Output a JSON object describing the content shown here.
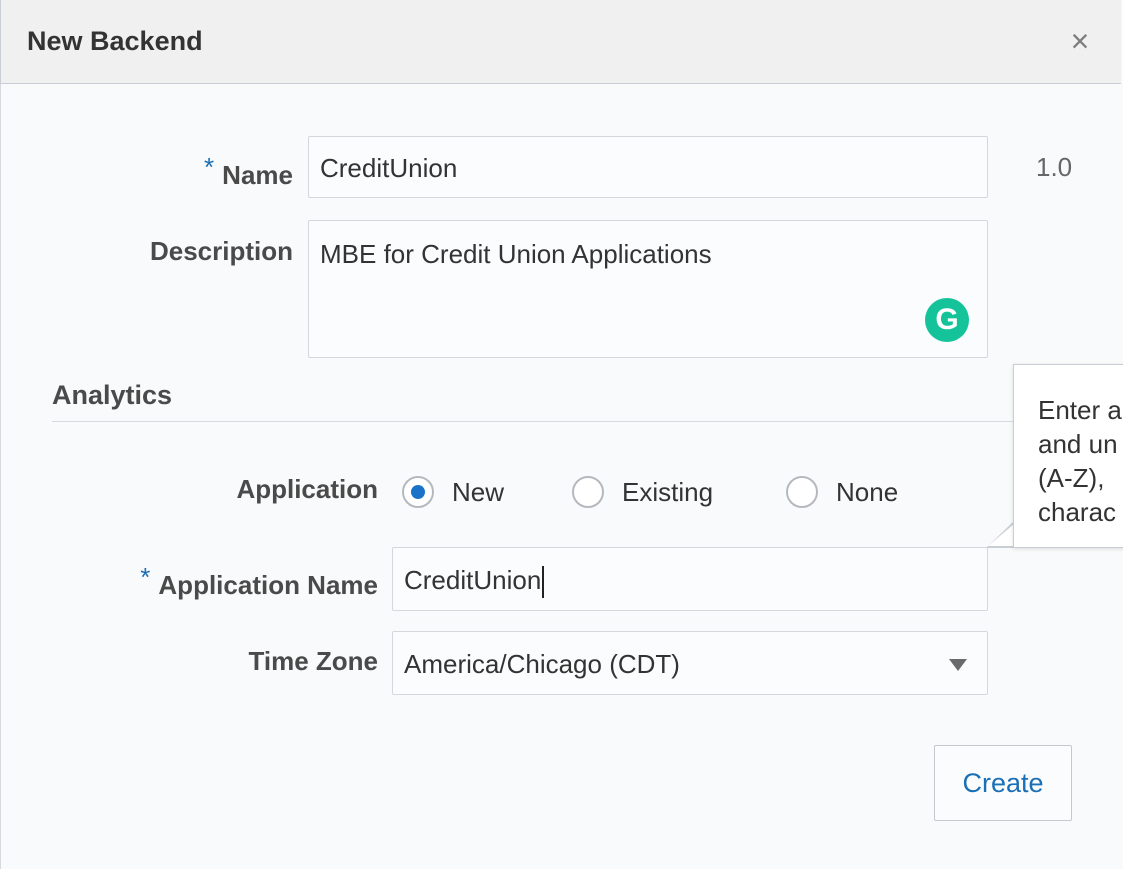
{
  "dialog": {
    "title": "New Backend",
    "close_icon": "×"
  },
  "form": {
    "name": {
      "label": "Name",
      "required_mark": "*",
      "value": "CreditUnion",
      "version": "1.0"
    },
    "description": {
      "label": "Description",
      "value": "MBE for Credit Union Applications"
    },
    "grammarly_icon": "G"
  },
  "analytics": {
    "section_title": "Analytics",
    "application": {
      "label": "Application",
      "options": [
        {
          "label": "New",
          "selected": true
        },
        {
          "label": "Existing",
          "selected": false
        },
        {
          "label": "None",
          "selected": false
        }
      ]
    },
    "application_name": {
      "label": "Application Name",
      "required_mark": "*",
      "value": "CreditUnion"
    },
    "time_zone": {
      "label": "Time Zone",
      "value": "America/Chicago (CDT)"
    }
  },
  "tooltip": {
    "lines": [
      "Enter a",
      "and un",
      "(A-Z),",
      "charac"
    ]
  },
  "actions": {
    "create_label": "Create"
  },
  "colors": {
    "accent": "#1a73c9",
    "required": "#1a6fb5",
    "grammarly": "#15c39a"
  }
}
